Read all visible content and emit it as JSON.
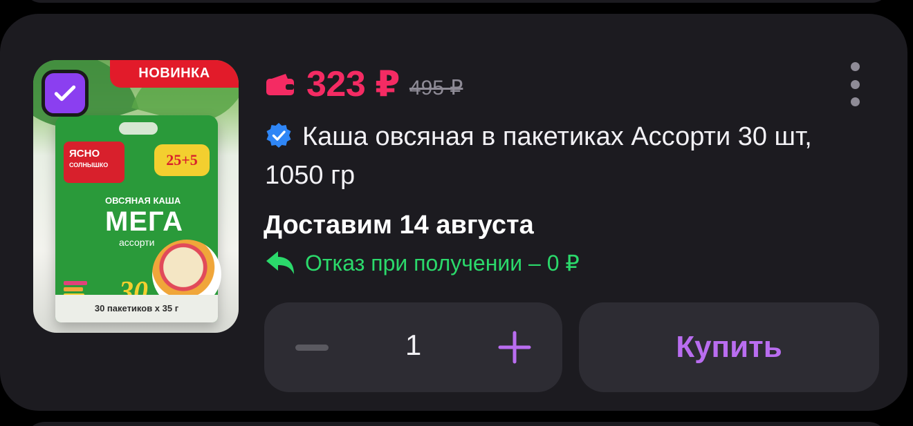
{
  "product": {
    "image": {
      "ribbon": "НОВИНКА",
      "brand_line1": "ЯСНО",
      "brand_line2": "СОЛНЫШКО",
      "badge": "25+5",
      "sub": "ОВСЯНАЯ КАША",
      "name": "МЕГА",
      "sub2": "ассорти",
      "count": "30",
      "footer": "30 пакетиков х 35 г"
    },
    "selected": true,
    "price": "323 ₽",
    "old_price": "495 ₽",
    "title": "Каша овсяная в пакетиках Ассорти 30 шт, 1050 гр",
    "delivery": "Доставим 14 августа",
    "refund": "Отказ при получении – 0 ₽",
    "quantity": "1",
    "buy_label": "Купить"
  },
  "colors": {
    "background": "#000000",
    "card": "#1c1b20",
    "control": "#2d2c33",
    "price": "#f42b63",
    "old_price": "#8e8b96",
    "refund": "#2bd96b",
    "accent": "#b96df0",
    "checkbox": "#8b3ff0",
    "verified": "#2f86f6"
  },
  "icons": {
    "wallet": "wallet-icon",
    "verified": "verified-badge-icon",
    "refund": "return-arrow-icon",
    "more": "more-vertical-icon",
    "minus": "minus-icon",
    "plus": "plus-icon",
    "check": "check-icon"
  }
}
